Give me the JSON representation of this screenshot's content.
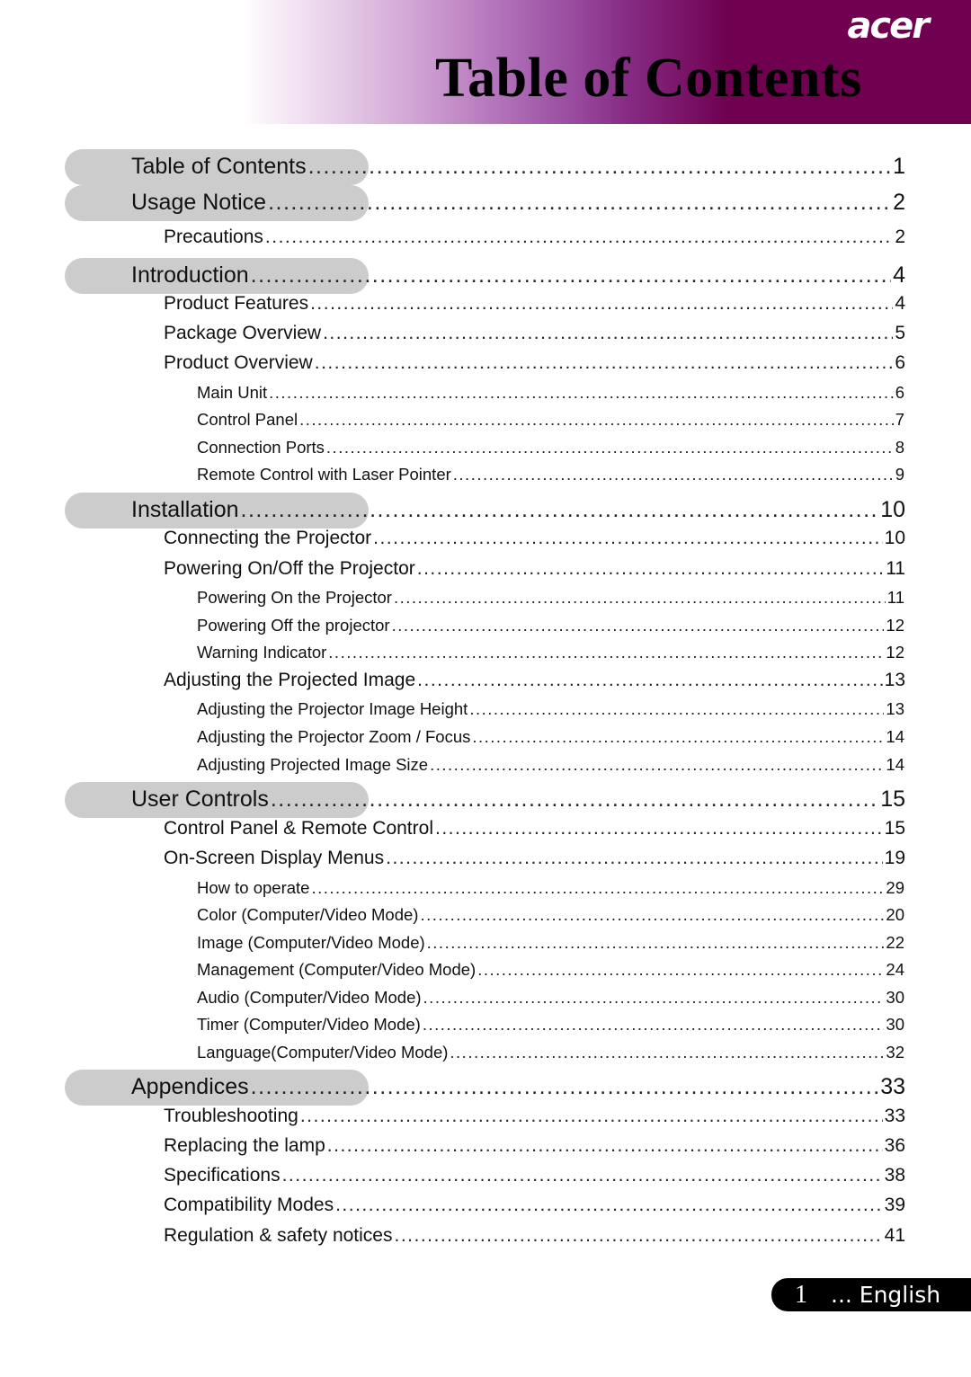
{
  "header": {
    "brand": "acer",
    "title": "Table of Contents",
    "colors": {
      "banner_dark": "#700050",
      "banner_mid": "#984a9e",
      "banner_light": "#e0c2e2",
      "pill": "#cccccc"
    }
  },
  "toc": [
    {
      "level": 1,
      "label": "Table of Contents",
      "page": "1"
    },
    {
      "level": 1,
      "label": "Usage Notice",
      "page": "2"
    },
    {
      "level": 2,
      "label": "Precautions",
      "page": "2"
    },
    {
      "level": 1,
      "label": "Introduction",
      "page": "4"
    },
    {
      "level": 2,
      "label": "Product Features",
      "page": "4"
    },
    {
      "level": 2,
      "label": "Package Overview",
      "page": "5"
    },
    {
      "level": 2,
      "label": "Product Overview",
      "page": "6"
    },
    {
      "level": 3,
      "label": "Main Unit",
      "page": "6"
    },
    {
      "level": 3,
      "label": "Control Panel",
      "page": "7"
    },
    {
      "level": 3,
      "label": "Connection Ports",
      "page": "8"
    },
    {
      "level": 3,
      "label": "Remote Control with Laser Pointer",
      "page": "9"
    },
    {
      "level": 1,
      "label": "Installation",
      "page": "10"
    },
    {
      "level": 2,
      "label": "Connecting the Projector",
      "page": "10"
    },
    {
      "level": 2,
      "label": "Powering On/Off the Projector",
      "page": "11"
    },
    {
      "level": 3,
      "label": "Powering On the Projector",
      "page": "11"
    },
    {
      "level": 3,
      "label": "Powering Off the projector",
      "page": "12"
    },
    {
      "level": 3,
      "label": "Warning Indicator",
      "page": "12"
    },
    {
      "level": 2,
      "label": "Adjusting the Projected Image",
      "page": "13"
    },
    {
      "level": 3,
      "label": "Adjusting the Projector Image Height",
      "page": "13"
    },
    {
      "level": 3,
      "label": "Adjusting the Projector Zoom / Focus",
      "page": "14"
    },
    {
      "level": 3,
      "label": "Adjusting Projected Image Size",
      "page": "14"
    },
    {
      "level": 1,
      "label": "User Controls",
      "page": "15"
    },
    {
      "level": 2,
      "label": "Control Panel & Remote Control",
      "page": "15"
    },
    {
      "level": 2,
      "label": "On-Screen Display Menus",
      "page": "19"
    },
    {
      "level": 3,
      "label": "How to operate",
      "page": "29"
    },
    {
      "level": 3,
      "label": "Color (Computer/Video Mode)",
      "page": "20"
    },
    {
      "level": 3,
      "label": "Image (Computer/Video Mode)",
      "page": "22"
    },
    {
      "level": 3,
      "label": "Management (Computer/Video Mode)",
      "page": "24"
    },
    {
      "level": 3,
      "label": "Audio (Computer/Video Mode)",
      "page": "30"
    },
    {
      "level": 3,
      "label": "Timer (Computer/Video Mode)",
      "page": "30"
    },
    {
      "level": 3,
      "label": "Language(Computer/Video Mode)",
      "page": "32"
    },
    {
      "level": 1,
      "label": "Appendices",
      "page": "33"
    },
    {
      "level": 2,
      "label": "Troubleshooting",
      "page": "33"
    },
    {
      "level": 2,
      "label": "Replacing the lamp",
      "page": "36"
    },
    {
      "level": 2,
      "label": "Specifications",
      "page": "38"
    },
    {
      "level": 2,
      "label": "Compatibility Modes",
      "page": "39"
    },
    {
      "level": 2,
      "label": "Regulation & safety notices",
      "page": "41"
    }
  ],
  "footer": {
    "page_number": "1",
    "language": "... English"
  }
}
